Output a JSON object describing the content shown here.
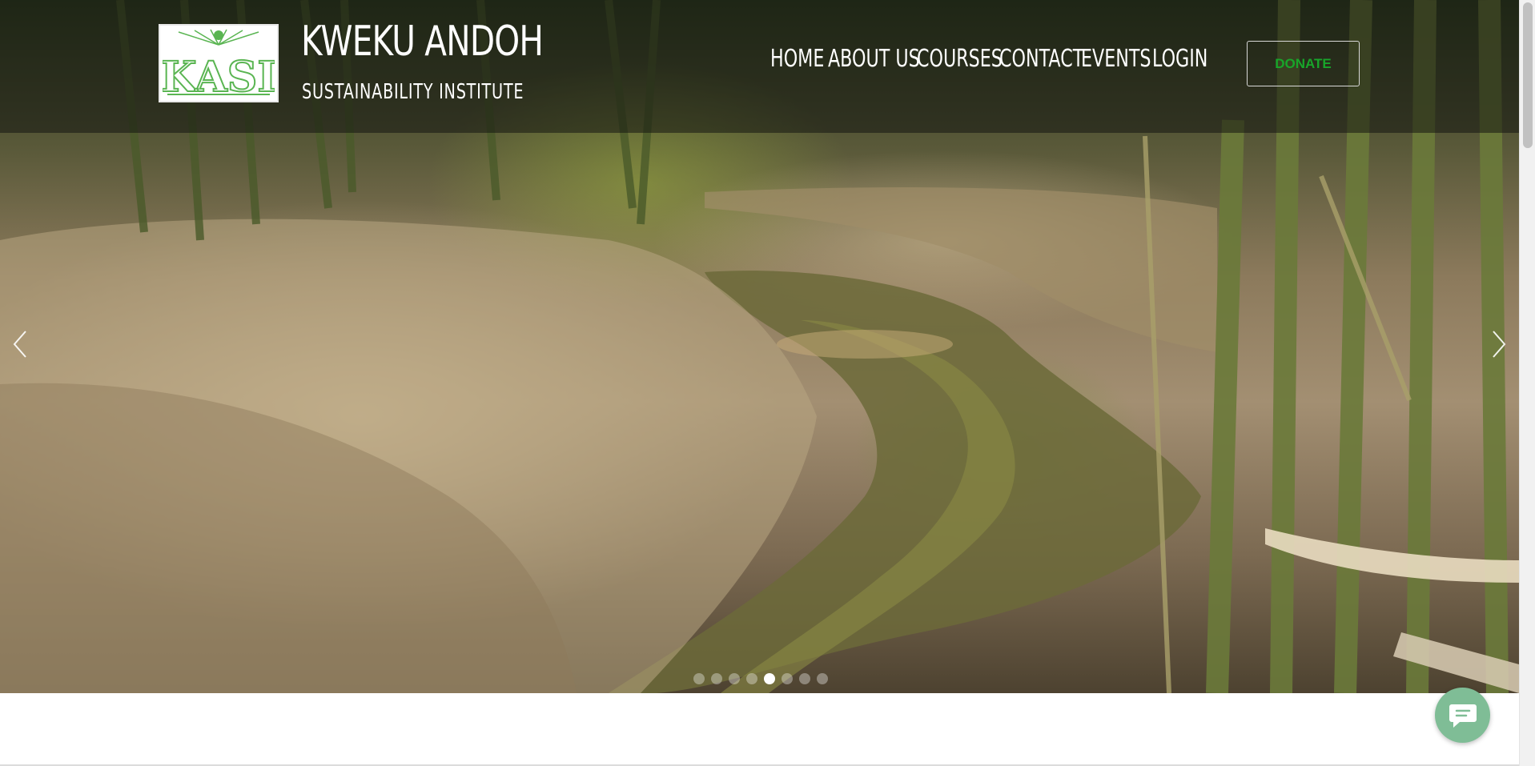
{
  "brand": {
    "logo_text": "KASI",
    "title": "KWEKU ANDOH",
    "subtitle": "SUSTAINABILITY INSTITUTE"
  },
  "nav": {
    "items": [
      {
        "label": "HOME"
      },
      {
        "label": "ABOUT US"
      },
      {
        "label": "COURSES"
      },
      {
        "label": "CONTACT"
      },
      {
        "label": "EVENTS"
      },
      {
        "label": "LOGIN"
      }
    ],
    "donate_label": "DONATE"
  },
  "slider": {
    "slide_count": 8,
    "active_slide": 5,
    "prev_icon": "chevron-left-icon",
    "next_icon": "chevron-right-icon"
  },
  "chat": {
    "icon": "chat-bubble-icon"
  },
  "colors": {
    "donate_text": "#18a52a",
    "chat_button": "#7fbd96",
    "logo_green": "#5ab552"
  }
}
